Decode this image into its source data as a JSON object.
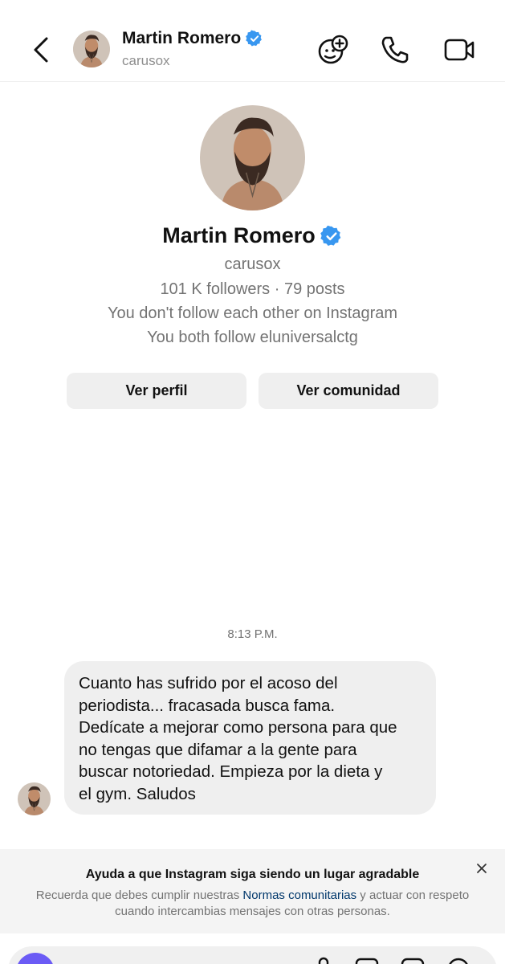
{
  "header": {
    "name": "Martin Romero",
    "username": "carusox"
  },
  "profile": {
    "name": "Martin Romero",
    "username": "carusox",
    "stats": "101 K followers · 79 posts",
    "follow_status": "You don't follow each other on Instagram",
    "mutual": "You both follow eluniversalctg",
    "view_profile_label": "Ver perfil",
    "view_community_label": "Ver comunidad"
  },
  "conversation": {
    "timestamp": "8:13 P.M.",
    "message": "Cuanto has sufrido por el acoso del\nperiodista... fracasada busca fama.\nDedícate a mejorar como persona para que\nno tengas que difamar a la gente para\nbuscar notoriedad. Empieza por la dieta y\nel gym. Saludos"
  },
  "notice": {
    "title": "Ayuda a que Instagram siga siendo un lugar agradable",
    "body_before": "Recuerda que debes cumplir nuestras ",
    "link": "Normas comunitarias",
    "body_after": " y actuar con respeto cuando intercambias mensajes con otras personas."
  },
  "colors": {
    "verified": "#3897f0",
    "secondary_text": "#737373",
    "button_bg": "#efefef",
    "bubble_bg": "#efefef",
    "notice_bg": "#f4f4f4",
    "link": "#00376b",
    "camera_button": "#6b5bf5"
  },
  "icons": [
    "back-chevron-icon",
    "verified-badge-icon",
    "add-people-icon",
    "phone-icon",
    "video-camera-icon",
    "close-icon",
    "camera-icon",
    "microphone-icon",
    "image-icon",
    "sticker-icon",
    "plus-icon"
  ]
}
